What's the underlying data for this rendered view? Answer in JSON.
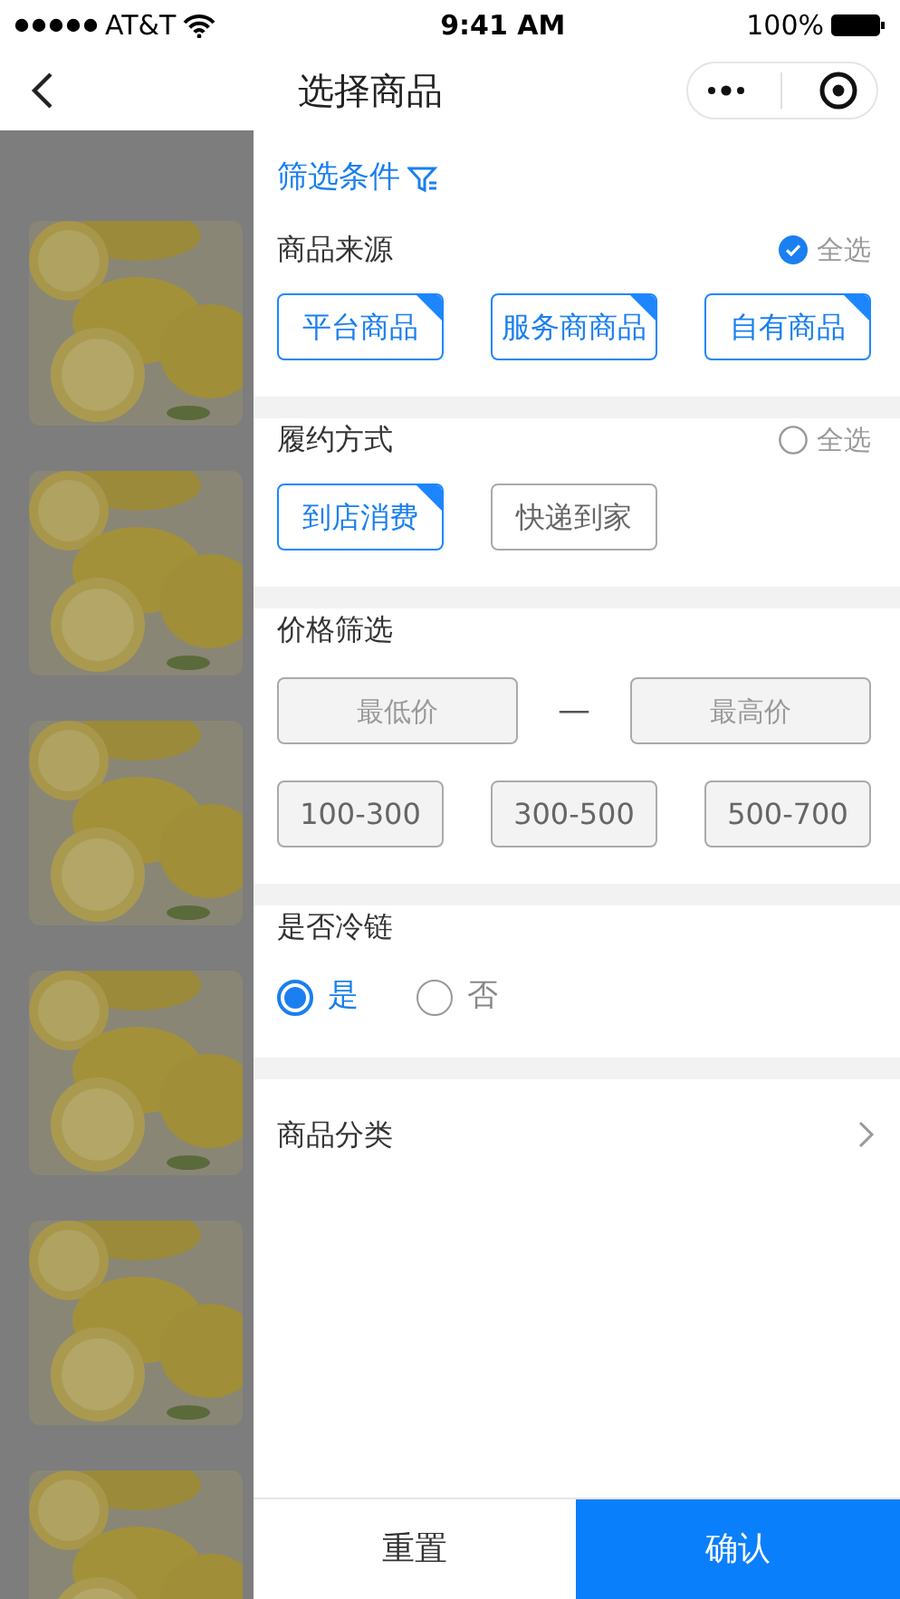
{
  "status_bar": {
    "carrier": "AT&T",
    "time": "9:41 AM",
    "battery": "100%"
  },
  "nav": {
    "title": "选择商品"
  },
  "filter_panel": {
    "title": "筛选条件",
    "sections": [
      {
        "kind": "chips",
        "title": "商品来源",
        "select_all": {
          "label": "全选",
          "checked": true
        },
        "options": [
          {
            "label": "平台商品",
            "selected": true
          },
          {
            "label": "服务商商品",
            "selected": true
          },
          {
            "label": "自有商品",
            "selected": true
          }
        ]
      },
      {
        "kind": "chips",
        "title": "履约方式",
        "select_all": {
          "label": "全选",
          "checked": false
        },
        "options": [
          {
            "label": "到店消费",
            "selected": true
          },
          {
            "label": "快递到家",
            "selected": false
          }
        ]
      },
      {
        "kind": "price",
        "title": "价格筛选",
        "min": {
          "placeholder": "最低价"
        },
        "separator": "—",
        "max": {
          "placeholder": "最高价"
        },
        "options": [
          {
            "label": "100-300",
            "selected": false
          },
          {
            "label": "300-500",
            "selected": false
          },
          {
            "label": "500-700",
            "selected": false
          }
        ]
      },
      {
        "kind": "radio",
        "title": "是否冷链",
        "options": [
          {
            "label": "是",
            "selected": true
          },
          {
            "label": "否",
            "selected": false
          }
        ]
      },
      {
        "kind": "link",
        "title": "商品分类"
      }
    ]
  },
  "footer": {
    "reset": "重置",
    "confirm": "确认"
  }
}
